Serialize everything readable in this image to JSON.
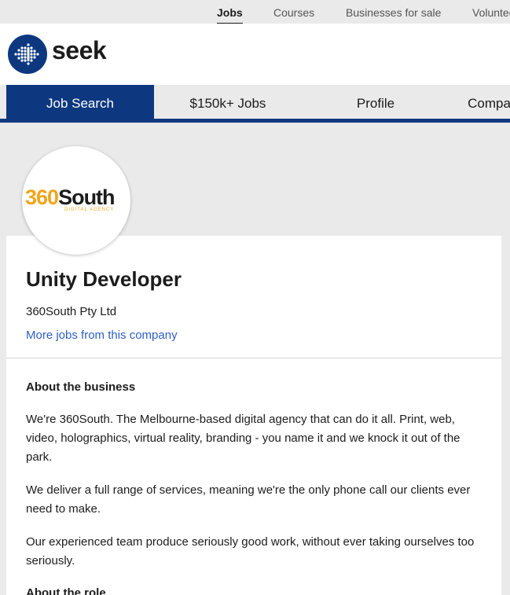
{
  "top_nav": {
    "items": [
      {
        "label": "Jobs",
        "active": true
      },
      {
        "label": "Courses",
        "active": false
      },
      {
        "label": "Businesses for sale",
        "active": false
      },
      {
        "label": "Volunteering",
        "active": false
      }
    ]
  },
  "brand": {
    "logo_icon": "seek-logo-icon",
    "name": "seek",
    "primary_color": "#0d3880"
  },
  "main_nav": {
    "tabs": [
      {
        "label": "Job Search",
        "active": true
      },
      {
        "label": "$150k+ Jobs",
        "active": false
      },
      {
        "label": "Profile",
        "active": false
      },
      {
        "label": "Company Reviews",
        "active": false
      }
    ]
  },
  "job": {
    "company_logo": {
      "number": "360",
      "word": "South",
      "tagline": "DIGITAL AGENCY",
      "accent_color": "#f3a51b"
    },
    "title": "Unity Developer",
    "company": "360South Pty Ltd",
    "more_jobs_link": "More jobs from this company"
  },
  "details": {
    "about_business_heading": "About the business",
    "paragraphs": [
      "We're 360South. The Melbourne-based digital agency that can do it all. Print, web, video, holographics, virtual reality, branding - you name it and we knock it out of the park.",
      "We deliver a full range of services, meaning we're the only phone call our clients ever need to make.",
      "Our experienced team produce seriously good work, without ever taking ourselves too seriously."
    ],
    "about_role_heading": "About the role"
  }
}
